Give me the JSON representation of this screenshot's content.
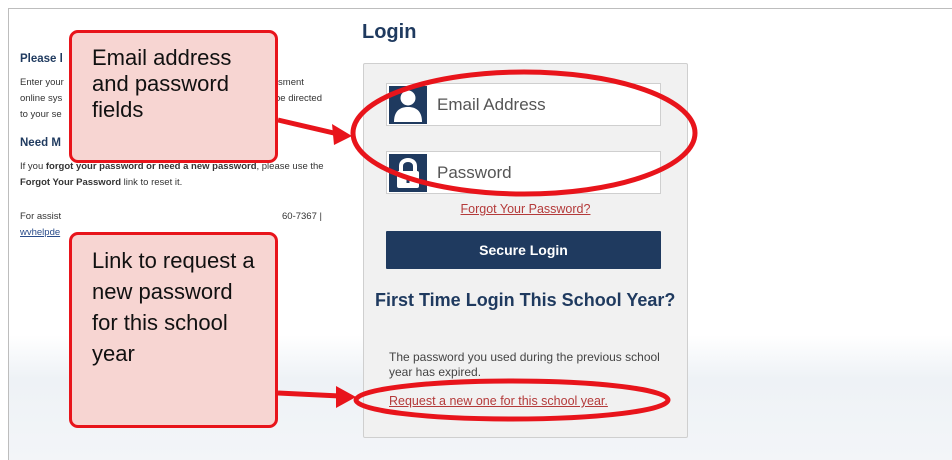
{
  "info": {
    "heading1": "Please l",
    "para1_line1": "Enter your",
    "para1_right1": "essment",
    "para1_line2": "online sys",
    "para1_right2": "be directed",
    "para1_line3": "to your se",
    "heading2": "Need M",
    "para2_pre": "If you ",
    "para2_bold": "forgot your password or need a new password",
    "para2_mid": ", please use the ",
    "para2_bold2": "Forgot Your Password",
    "para2_post": " link to reset it.",
    "para3_line1": "For assist",
    "para3_right": "60-7367 |",
    "para3_link": "wvhelpde"
  },
  "login": {
    "title": "Login",
    "email_placeholder": "Email Address",
    "password_placeholder": "Password",
    "forgot_link": "Forgot Your Password?",
    "secure_button": "Secure Login",
    "first_time_heading": "First Time Login This School Year?",
    "first_time_text": "The password you used during the previous school year has expired.",
    "request_link": "Request a new one for this school year."
  },
  "callouts": {
    "fields_label": "Email address and password fields",
    "link_label": "Link to request a new password for this school year"
  },
  "colors": {
    "navy": "#1f3a5f",
    "annotation_red": "#e8141b",
    "callout_fill": "#f7d5d2",
    "link_red": "#b43a3a"
  },
  "icons": {
    "email_field": "user-icon",
    "password_field": "lock-icon"
  }
}
